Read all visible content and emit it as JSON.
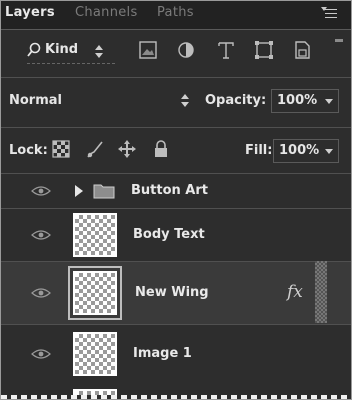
{
  "tabs": [
    {
      "label": "Layers",
      "active": true
    },
    {
      "label": "Channels",
      "active": false
    },
    {
      "label": "Paths",
      "active": false
    }
  ],
  "filter": {
    "kind_label": "Kind",
    "icons": [
      "pixel-filter-icon",
      "adjustment-filter-icon",
      "type-filter-icon",
      "shape-filter-icon",
      "smart-object-filter-icon"
    ]
  },
  "blend": {
    "mode": "Normal",
    "opacity_label": "Opacity:",
    "opacity_value": "100%"
  },
  "lock": {
    "label": "Lock:",
    "icons": [
      "lock-transparent-pixels-icon",
      "lock-image-pixels-icon",
      "lock-position-icon",
      "lock-all-icon"
    ],
    "fill_label": "Fill:",
    "fill_value": "100%"
  },
  "layers": [
    {
      "name": "Button Art",
      "type": "group",
      "selected": false
    },
    {
      "name": "Body Text",
      "type": "layer",
      "selected": false
    },
    {
      "name": "New Wing",
      "type": "layer",
      "selected": true,
      "has_fx": true
    },
    {
      "name": "Image 1",
      "type": "layer",
      "selected": false
    }
  ],
  "fx_symbol": "fx",
  "colors": {
    "panel_bg": "#2d2d2d",
    "text": "#e9e9e9",
    "inactive_tab": "#7b7b7b"
  }
}
